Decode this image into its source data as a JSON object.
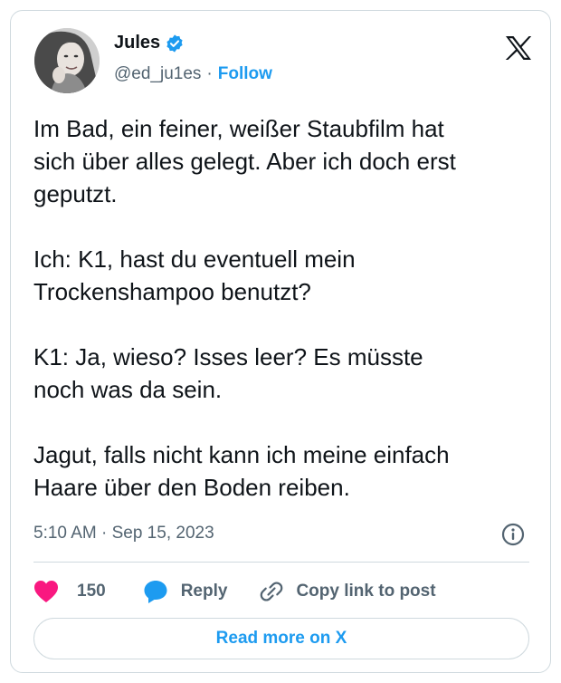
{
  "author": {
    "name": "Jules",
    "handle": "@ed_ju1es",
    "separator": "·",
    "follow_label": "Follow"
  },
  "tweet": {
    "text": "Im Bad, ein feiner, weißer Staubfilm hat\nsich über alles gelegt. Aber ich doch erst\ngeputzt.\n\nIch: K1, hast du eventuell mein\nTrockenshampoo benutzt?\n\nK1: Ja, wieso? Isses leer? Es müsste\nnoch was da sein.\n\nJagut, falls nicht kann ich meine einfach\nHaare über den Boden reiben.",
    "timestamp": "5:10 AM · Sep 15, 2023"
  },
  "actions": {
    "like_count": "150",
    "reply_label": "Reply",
    "copy_label": "Copy link to post"
  },
  "footer": {
    "read_more_label": "Read more on X"
  },
  "icons": {
    "verified": "verified-badge-icon",
    "x_logo": "x-logo-icon",
    "info": "info-icon",
    "like": "heart-icon",
    "reply": "speech-bubble-icon",
    "copy": "link-icon"
  },
  "colors": {
    "accent": "#1d9bf0",
    "like": "#f91880",
    "text": "#0f1419",
    "muted": "#536471",
    "border": "#cfd9de"
  }
}
